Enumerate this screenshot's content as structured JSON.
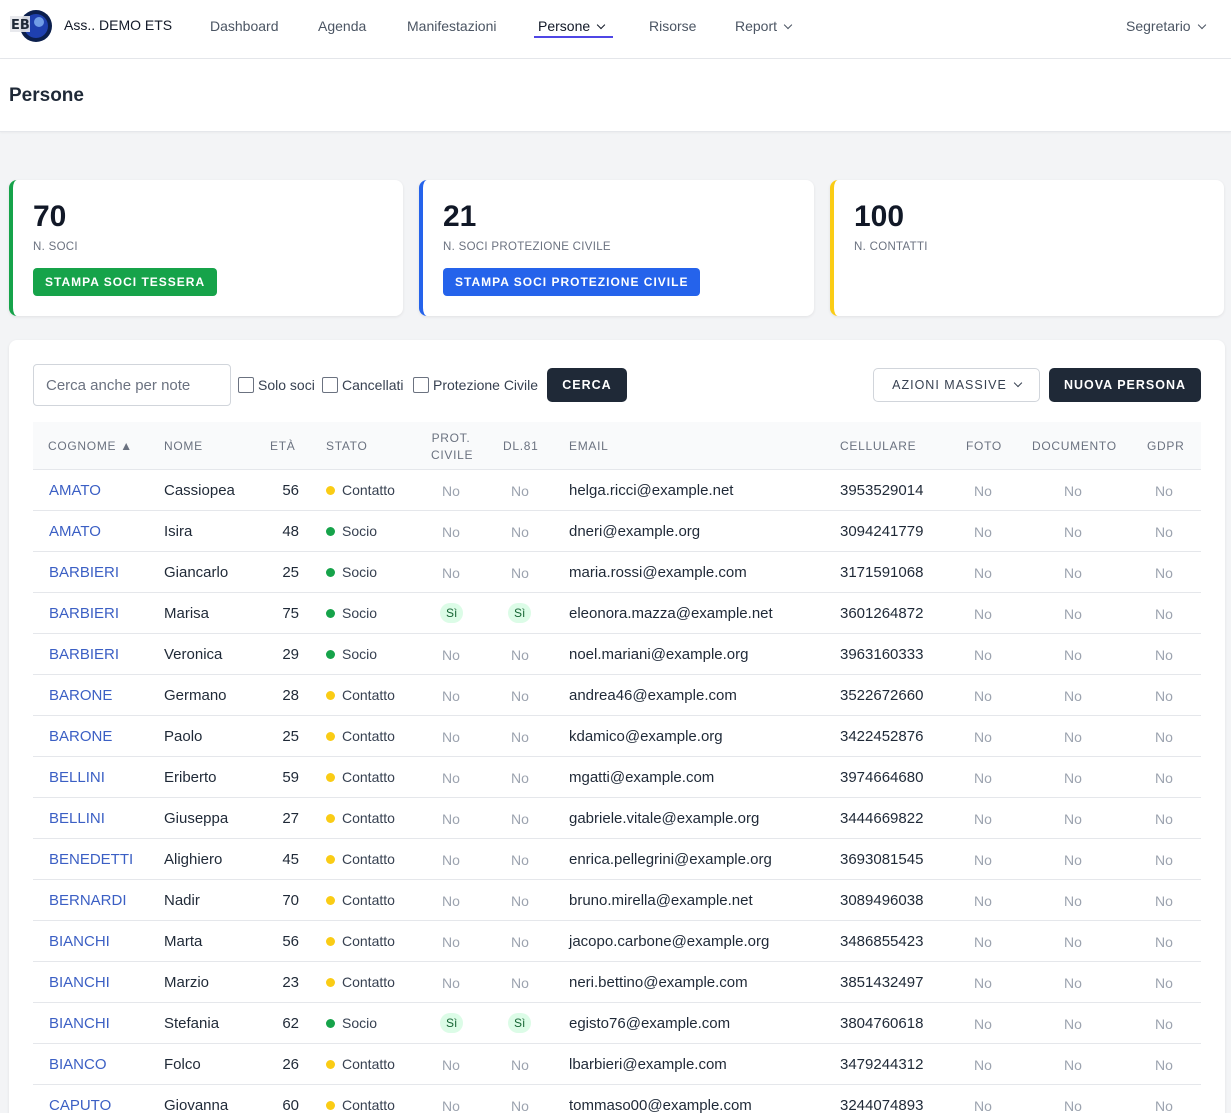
{
  "brand": {
    "name": "Ass.. DEMO ETS",
    "logo_text": "EB"
  },
  "nav": {
    "items": [
      {
        "label": "Dashboard"
      },
      {
        "label": "Agenda"
      },
      {
        "label": "Manifestazioni"
      },
      {
        "label": "Persone"
      },
      {
        "label": "Risorse"
      },
      {
        "label": "Report"
      }
    ],
    "user": "Segretario"
  },
  "page": {
    "title": "Persone"
  },
  "colors": {
    "green": "#16a34a",
    "blue": "#2563eb",
    "yellow": "#facc15",
    "link": "#3b5fc4",
    "dark": "#1f2937"
  },
  "stats": [
    {
      "value": "70",
      "label": "N. SOCI",
      "button": "STAMPA SOCI TESSERA"
    },
    {
      "value": "21",
      "label": "N. SOCI PROTEZIONE CIVILE",
      "button": "STAMPA SOCI PROTEZIONE CIVILE"
    },
    {
      "value": "100",
      "label": "N. CONTATTI"
    }
  ],
  "filters": {
    "search_placeholder": "Cerca anche per note",
    "solo_soci": "Solo soci",
    "cancellati": "Cancellati",
    "protezione_civile": "Protezione Civile",
    "search_button": "CERCA",
    "bulk_actions": "AZIONI MASSIVE",
    "new_person": "NUOVA PERSONA"
  },
  "table": {
    "headers": {
      "surname": "COGNOME",
      "sort_arrow": "▲",
      "name": "NOME",
      "age": "ETÀ",
      "status": "STATO",
      "prot_civile_1": "PROT.",
      "prot_civile_2": "CIVILE",
      "dl81": "DL.81",
      "email": "EMAIL",
      "phone": "CELLULARE",
      "photo": "FOTO",
      "document": "DOCUMENTO",
      "gdpr": "GDPR"
    },
    "rows": [
      {
        "surname": "AMATO",
        "name": "Cassiopea",
        "age": "56",
        "status": "Contatto",
        "prot": "No",
        "dl81": "No",
        "email": "helga.ricci@example.net",
        "phone": "3953529014",
        "photo": "No",
        "doc": "No",
        "gdpr": "No"
      },
      {
        "surname": "AMATO",
        "name": "Isira",
        "age": "48",
        "status": "Socio",
        "prot": "No",
        "dl81": "No",
        "email": "dneri@example.org",
        "phone": "3094241779",
        "photo": "No",
        "doc": "No",
        "gdpr": "No"
      },
      {
        "surname": "BARBIERI",
        "name": "Giancarlo",
        "age": "25",
        "status": "Socio",
        "prot": "No",
        "dl81": "No",
        "email": "maria.rossi@example.com",
        "phone": "3171591068",
        "photo": "No",
        "doc": "No",
        "gdpr": "No"
      },
      {
        "surname": "BARBIERI",
        "name": "Marisa",
        "age": "75",
        "status": "Socio",
        "prot": "Sì",
        "dl81": "Sì",
        "email": "eleonora.mazza@example.net",
        "phone": "3601264872",
        "photo": "No",
        "doc": "No",
        "gdpr": "No"
      },
      {
        "surname": "BARBIERI",
        "name": "Veronica",
        "age": "29",
        "status": "Socio",
        "prot": "No",
        "dl81": "No",
        "email": "noel.mariani@example.org",
        "phone": "3963160333",
        "photo": "No",
        "doc": "No",
        "gdpr": "No"
      },
      {
        "surname": "BARONE",
        "name": "Germano",
        "age": "28",
        "status": "Contatto",
        "prot": "No",
        "dl81": "No",
        "email": "andrea46@example.com",
        "phone": "3522672660",
        "photo": "No",
        "doc": "No",
        "gdpr": "No"
      },
      {
        "surname": "BARONE",
        "name": "Paolo",
        "age": "25",
        "status": "Contatto",
        "prot": "No",
        "dl81": "No",
        "email": "kdamico@example.org",
        "phone": "3422452876",
        "photo": "No",
        "doc": "No",
        "gdpr": "No"
      },
      {
        "surname": "BELLINI",
        "name": "Eriberto",
        "age": "59",
        "status": "Contatto",
        "prot": "No",
        "dl81": "No",
        "email": "mgatti@example.com",
        "phone": "3974664680",
        "photo": "No",
        "doc": "No",
        "gdpr": "No"
      },
      {
        "surname": "BELLINI",
        "name": "Giuseppa",
        "age": "27",
        "status": "Contatto",
        "prot": "No",
        "dl81": "No",
        "email": "gabriele.vitale@example.org",
        "phone": "3444669822",
        "photo": "No",
        "doc": "No",
        "gdpr": "No"
      },
      {
        "surname": "BENEDETTI",
        "name": "Alighiero",
        "age": "45",
        "status": "Contatto",
        "prot": "No",
        "dl81": "No",
        "email": "enrica.pellegrini@example.org",
        "phone": "3693081545",
        "photo": "No",
        "doc": "No",
        "gdpr": "No"
      },
      {
        "surname": "BERNARDI",
        "name": "Nadir",
        "age": "70",
        "status": "Contatto",
        "prot": "No",
        "dl81": "No",
        "email": "bruno.mirella@example.net",
        "phone": "3089496038",
        "photo": "No",
        "doc": "No",
        "gdpr": "No"
      },
      {
        "surname": "BIANCHI",
        "name": "Marta",
        "age": "56",
        "status": "Contatto",
        "prot": "No",
        "dl81": "No",
        "email": "jacopo.carbone@example.org",
        "phone": "3486855423",
        "photo": "No",
        "doc": "No",
        "gdpr": "No"
      },
      {
        "surname": "BIANCHI",
        "name": "Marzio",
        "age": "23",
        "status": "Contatto",
        "prot": "No",
        "dl81": "No",
        "email": "neri.bettino@example.com",
        "phone": "3851432497",
        "photo": "No",
        "doc": "No",
        "gdpr": "No"
      },
      {
        "surname": "BIANCHI",
        "name": "Stefania",
        "age": "62",
        "status": "Socio",
        "prot": "Sì",
        "dl81": "Sì",
        "email": "egisto76@example.com",
        "phone": "3804760618",
        "photo": "No",
        "doc": "No",
        "gdpr": "No"
      },
      {
        "surname": "BIANCO",
        "name": "Folco",
        "age": "26",
        "status": "Contatto",
        "prot": "No",
        "dl81": "No",
        "email": "lbarbieri@example.com",
        "phone": "3479244312",
        "photo": "No",
        "doc": "No",
        "gdpr": "No"
      },
      {
        "surname": "CAPUTO",
        "name": "Giovanna",
        "age": "60",
        "status": "Contatto",
        "prot": "No",
        "dl81": "No",
        "email": "tommaso00@example.com",
        "phone": "3244074893",
        "photo": "No",
        "doc": "No",
        "gdpr": "No"
      }
    ]
  }
}
